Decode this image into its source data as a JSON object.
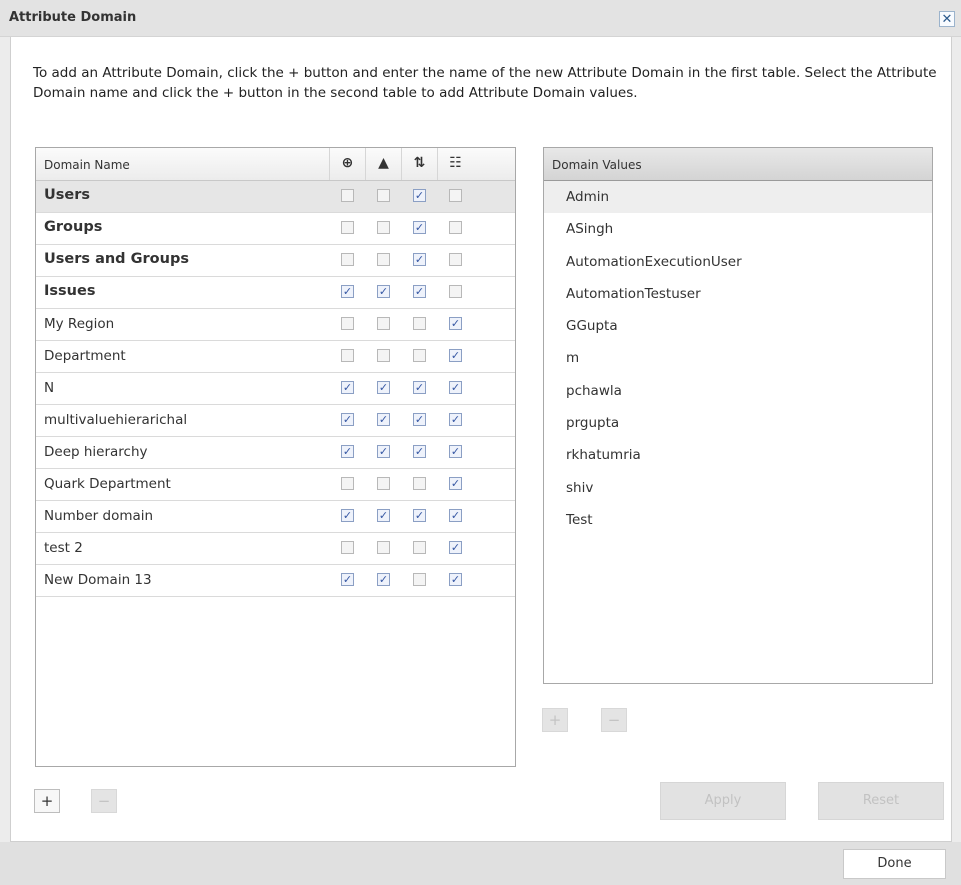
{
  "dialog": {
    "title": "Attribute Domain",
    "close_label": "✕",
    "instructions": "To add an Attribute Domain, click the + button and enter the name of the new Attribute Domain in the first table. Select the Attribute Domain name and click the + button in the second table to add Attribute Domain values."
  },
  "domain_table": {
    "columns": [
      {
        "label": "Domain Name"
      },
      {
        "icon": "circle-plus-icon",
        "glyph": "⊕"
      },
      {
        "icon": "warning-icon",
        "glyph": "▲"
      },
      {
        "icon": "sort-arrows-icon",
        "glyph": "⇅"
      },
      {
        "icon": "hierarchy-icon",
        "glyph": "☷"
      }
    ],
    "rows": [
      {
        "name": "Users",
        "bold": true,
        "selected": true,
        "flags": [
          false,
          false,
          true,
          false
        ]
      },
      {
        "name": "Groups",
        "bold": true,
        "selected": false,
        "flags": [
          false,
          false,
          true,
          false
        ]
      },
      {
        "name": "Users and Groups",
        "bold": true,
        "selected": false,
        "flags": [
          false,
          false,
          true,
          false
        ]
      },
      {
        "name": "Issues",
        "bold": true,
        "selected": false,
        "flags": [
          true,
          true,
          true,
          false
        ]
      },
      {
        "name": "My Region",
        "bold": false,
        "selected": false,
        "flags": [
          false,
          false,
          false,
          true
        ]
      },
      {
        "name": "Department",
        "bold": false,
        "selected": false,
        "flags": [
          false,
          false,
          false,
          true
        ]
      },
      {
        "name": "N",
        "bold": false,
        "selected": false,
        "flags": [
          true,
          true,
          true,
          true
        ]
      },
      {
        "name": "multivaluehierarichal",
        "bold": false,
        "selected": false,
        "flags": [
          true,
          true,
          true,
          true
        ]
      },
      {
        "name": "Deep hierarchy",
        "bold": false,
        "selected": false,
        "flags": [
          true,
          true,
          true,
          true
        ]
      },
      {
        "name": "Quark Department",
        "bold": false,
        "selected": false,
        "flags": [
          false,
          false,
          false,
          true
        ]
      },
      {
        "name": "Number domain",
        "bold": false,
        "selected": false,
        "flags": [
          true,
          true,
          true,
          true
        ]
      },
      {
        "name": "test 2",
        "bold": false,
        "selected": false,
        "flags": [
          false,
          false,
          false,
          true
        ]
      },
      {
        "name": "New Domain 13",
        "bold": false,
        "selected": false,
        "flags": [
          true,
          true,
          false,
          true
        ]
      }
    ],
    "add_label": "+",
    "remove_label": "−"
  },
  "values_table": {
    "header": "Domain Values",
    "values": [
      "Admin",
      "ASingh",
      "AutomationExecutionUser",
      "AutomationTestuser",
      "GGupta",
      "m",
      "pchawla",
      "prgupta",
      "rkhatumria",
      "shiv",
      "Test"
    ],
    "selected_index": 0,
    "add_label": "+",
    "remove_label": "−"
  },
  "buttons": {
    "apply": "Apply",
    "reset": "Reset",
    "done": "Done"
  },
  "colors": {
    "check": "#3557a3",
    "title_bar": "#e3e3e3"
  }
}
